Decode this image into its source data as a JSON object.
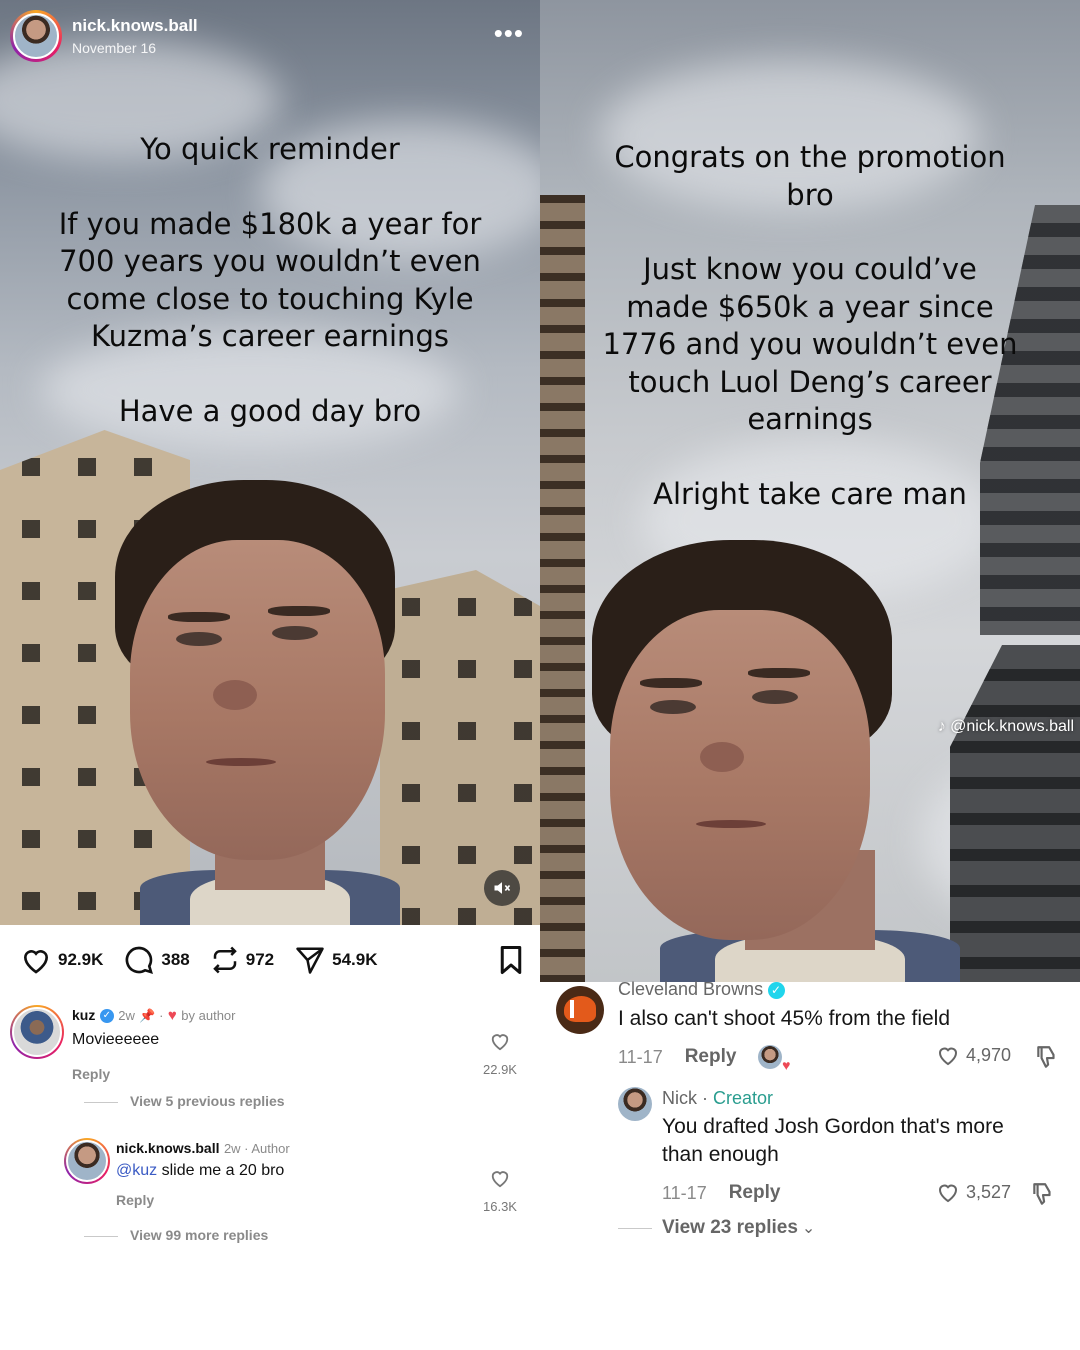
{
  "left": {
    "post": {
      "username": "nick.knows.ball",
      "date": "November 16",
      "more_icon": "more-dots-icon",
      "overlay_lines": [
        "Yo quick reminder",
        "If you made $180k a year for\n700 years you wouldn’t even\ncome close to touching Kyle\nKuzma’s career earnings",
        "Have a good day bro"
      ],
      "mute_icon": "volume-muted-icon"
    },
    "actions": {
      "likes": "92.9K",
      "comments": "388",
      "reposts": "972",
      "shares": "54.9K"
    },
    "comments": [
      {
        "username": "kuz",
        "verified": true,
        "age": "2w",
        "pinned": true,
        "liked_by_author": "by author",
        "text": "Movieeeeee",
        "reply": "Reply",
        "likes": "22.9K",
        "view_more": "View 5 previous replies"
      },
      {
        "username": "nick.knows.ball",
        "age": "2w · Author",
        "mention": "@kuz",
        "text": " slide me a 20 bro",
        "reply": "Reply",
        "likes": "16.3K",
        "view_more": "View 99 more replies"
      }
    ]
  },
  "right": {
    "overlay_lines": [
      "Congrats on the promotion\nbro",
      "Just know you could’ve\nmade $650k a year since\n1776 and you wouldn’t even\ntouch Luol Deng’s career\nearnings",
      "Alright take care man"
    ],
    "watermark": "@nick.knows.ball",
    "comments": [
      {
        "username": "Cleveland Browns",
        "verified": true,
        "text": "I also can't shoot 45% from the field",
        "date": "11-17",
        "reply": "Reply",
        "likes": "4,970"
      },
      {
        "username": "Nick",
        "badge_sep": " · ",
        "badge": "Creator",
        "text": "You drafted Josh Gordon that's more\nthan enough",
        "date": "11-17",
        "reply": "Reply",
        "likes": "3,527",
        "view_replies": "View 23 replies"
      }
    ]
  },
  "colors": {
    "accent_blue": "#3897f0",
    "creator_teal": "#2a9d8f",
    "like_red": "#ed4956",
    "browns_orange": "#e35a1b",
    "browns_brown": "#4a2a16"
  }
}
